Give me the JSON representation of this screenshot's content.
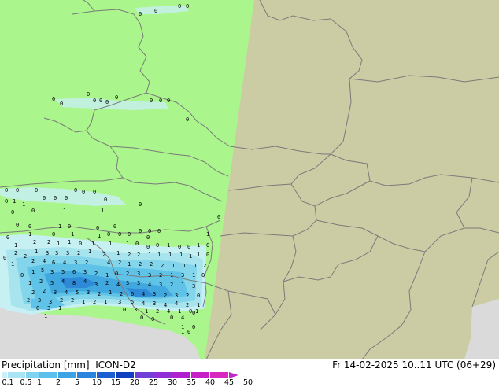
{
  "legend": {
    "title": "Precipitation [mm]",
    "model": "ICON-D2",
    "valid_time": "Fr 14-02-2025 10..11 UTC (06+29)",
    "colors": [
      "#c8f0f8",
      "#a8e4f4",
      "#80d4f0",
      "#5cc0ec",
      "#3ca4e4",
      "#2884dc",
      "#1c60d0",
      "#1040c0",
      "#7040d8",
      "#9030d8",
      "#b020d0",
      "#c820c8",
      "#d828c0"
    ],
    "ticks": [
      "0.1",
      "0.5",
      "1",
      "2",
      "5",
      "10",
      "15",
      "20",
      "25",
      "30",
      "35",
      "40",
      "45",
      "50"
    ]
  },
  "map": {
    "colors": {
      "model_domain": "#aaf58c",
      "outside_domain": "#cccca4",
      "sea": "#dadada",
      "borders": "#7a7a7a"
    }
  }
}
